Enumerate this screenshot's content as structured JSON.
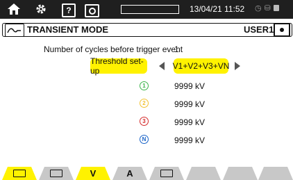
{
  "status_bar": {
    "datetime": "13/04/21 11:52",
    "icons": [
      "home-icon",
      "settings-icon",
      "help-icon",
      "camera-icon",
      "clock-icon",
      "network-icon",
      "battery-icon"
    ],
    "help_glyph": "?",
    "memory_level_fraction": 0.0
  },
  "header": {
    "title": "TRANSIENT MODE",
    "user": "USER1"
  },
  "settings": {
    "cycles_label": "Number of cycles before trigger event",
    "cycles_value": "1",
    "threshold_label": "Threshold set-up",
    "threshold_selection": "V1+V2+V3+VN",
    "phases": [
      {
        "badge": "1",
        "color": "#3cb44b",
        "value": "9999 kV"
      },
      {
        "badge": "2",
        "color": "#f2c230",
        "value": "9999 kV"
      },
      {
        "badge": "3",
        "color": "#d52b2b",
        "value": "9999 kV"
      },
      {
        "badge": "N",
        "color": "#1a64c8",
        "value": "9999 kV"
      }
    ]
  },
  "tabs": [
    {
      "name": "transient-mode-tab",
      "label": "",
      "icon": "waveform-icon",
      "active": true
    },
    {
      "name": "inrush-tab",
      "label": "",
      "icon": "inrush-icon",
      "active": false
    },
    {
      "name": "voltage-tab",
      "label": "V",
      "active": true
    },
    {
      "name": "current-tab",
      "label": "A",
      "active": false
    },
    {
      "name": "envelope-tab",
      "label": "",
      "icon": "envelope-icon",
      "active": false
    },
    {
      "name": "empty-tab-1",
      "label": "",
      "active": false
    },
    {
      "name": "empty-tab-2",
      "label": "",
      "active": false
    },
    {
      "name": "empty-tab-3",
      "label": "",
      "active": false
    }
  ],
  "colors": {
    "accent": "#fff200",
    "status_bar_bg": "#1f1f1f",
    "tab_inactive": "#c8c8c8"
  }
}
